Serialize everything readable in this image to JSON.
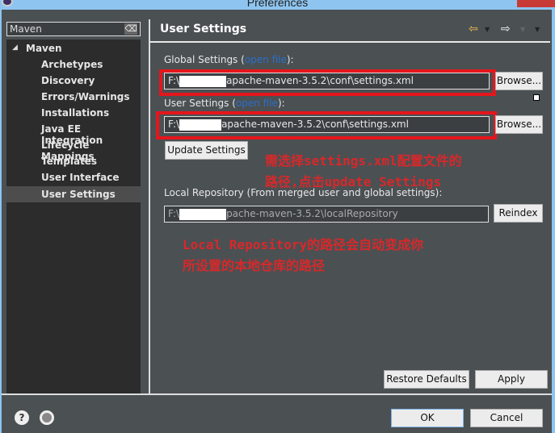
{
  "window": {
    "title": "Preferences"
  },
  "sidebar": {
    "filter_value": "Maven",
    "items": [
      {
        "label": "Maven",
        "expanded": true
      },
      {
        "label": "Archetypes"
      },
      {
        "label": "Discovery"
      },
      {
        "label": "Errors/Warnings"
      },
      {
        "label": "Installations"
      },
      {
        "label": "Java EE Integration"
      },
      {
        "label": "Lifecycle Mappings"
      },
      {
        "label": "Templates"
      },
      {
        "label": "User Interface"
      },
      {
        "label": "User Settings",
        "selected": true
      }
    ]
  },
  "page": {
    "title": "User Settings",
    "global": {
      "label_pre": "Global Settings (",
      "link": "open file",
      "label_post": "):",
      "value_prefix": "F:\\",
      "value_suffix": "apache-maven-3.5.2\\conf\\settings.xml",
      "browse": "Browse..."
    },
    "user": {
      "label_pre": "User Settings (",
      "link": "open file",
      "label_post": "):",
      "value_prefix": "F:\\",
      "value_suffix": "apache-maven-3.5.2\\conf\\settings.xml",
      "browse": "Browse..."
    },
    "update": "Update Settings",
    "local": {
      "label": "Local Repository (From merged user and global settings):",
      "value_prefix": "F:\\",
      "value_suffix": "pache-maven-3.5.2\\localRepository",
      "reindex": "Reindex"
    },
    "restore": "Restore Defaults",
    "apply": "Apply"
  },
  "annotations": {
    "note1_line1": "需选择settings.xml配置文件的",
    "note1_line2": "路径,点击update Settings",
    "note2_line1": "Local Repository的路径会自动变成你",
    "note2_line2": "所设置的本地仓库的路径",
    "color": "#d8282a"
  },
  "footer": {
    "ok": "OK",
    "cancel": "Cancel",
    "help_icon": "?"
  }
}
